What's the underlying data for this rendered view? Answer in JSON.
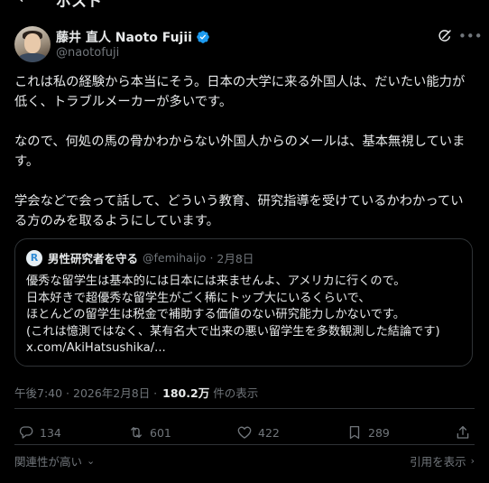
{
  "topbar": {
    "back_glyph": "←",
    "title": "ポスト"
  },
  "author": {
    "display_name": "藤井 直人 Naoto Fujii",
    "handle": "@naotofuji",
    "verified": true
  },
  "tweet": {
    "paragraphs": [
      "これは私の経験から本当にそう。日本の大学に来る外国人は、だいたい能力が低く、トラブルメーカーが多いです。",
      "なので、何処の馬の骨かわからない外国人からのメールは、基本無視しています。",
      "学会などで会って話して、どういう教育、研究指導を受けているかわかっている方のみを取るようにしています。"
    ]
  },
  "quote": {
    "avatar_letter": "R",
    "name": "男性研究者を守る",
    "handle": "@femihaijo",
    "separator": "·",
    "date": "2月8日",
    "lines": [
      "優秀な留学生は基本的には日本には来ませんよ、アメリカに行くので。",
      "日本好きで超優秀な留学生がごく稀にトップ大にいるくらいで、",
      "ほとんどの留学生は税金で補助する価値のない研究能力しかないです。",
      "(これは憶測ではなく、某有名大で出来の悪い留学生を多数観測した結論です)",
      "x.com/AkiHatsushika/..."
    ]
  },
  "meta": {
    "time": "午後7:40 · 2026年2月8日 · ",
    "views_count": "180.2万",
    "views_label": "件の表示"
  },
  "actions": {
    "replies": "134",
    "reposts": "601",
    "likes": "422",
    "bookmarks": "289"
  },
  "footer": {
    "sort_label": "関連性が高い",
    "quotes_label": "引用を表示"
  },
  "colors": {
    "background": "#000000",
    "text": "#e7e9ea",
    "muted": "#71767b",
    "border": "#2f3336",
    "verified": "#1d9bf0"
  },
  "icons": {
    "verified": "verified-badge-icon",
    "grok": "grok-icon",
    "more": "more-icon",
    "reply": "reply-icon",
    "repost": "repost-icon",
    "like": "heart-icon",
    "bookmark": "bookmark-icon",
    "share": "share-icon"
  }
}
